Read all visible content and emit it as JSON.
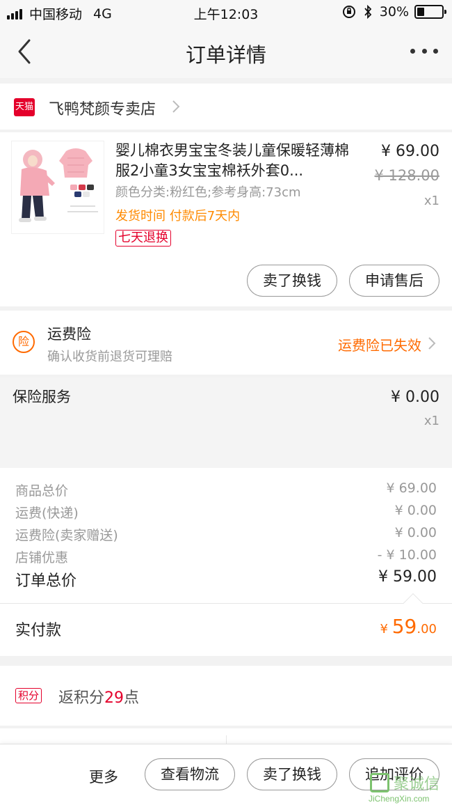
{
  "status_bar": {
    "carrier": "中国移动",
    "network": "4G",
    "time": "上午12:03",
    "battery": "30%",
    "battery_level": 0.3
  },
  "nav": {
    "title": "订单详情"
  },
  "store": {
    "badge": "天猫",
    "name": "飞鸭梵颜专卖店"
  },
  "product": {
    "title": "婴儿棉衣男宝宝冬装儿童保暖轻薄棉服2小童3女宝宝棉袄外套0...",
    "sku": "颜色分类:粉红色;参考身高:73cm",
    "ship_time": "发货时间 付款后7天内",
    "return_tag": "七天退换",
    "price": "¥ 69.00",
    "original_price": "¥ 128.00",
    "quantity": "x1",
    "btn_sell": "卖了换钱",
    "btn_after_sale": "申请售后"
  },
  "insurance": {
    "badge": "险",
    "title": "运费险",
    "desc": "确认收货前退货可理赔",
    "status": "运费险已失效"
  },
  "service": {
    "title": "保险服务",
    "price": "¥ 0.00",
    "quantity": "x1"
  },
  "summary": {
    "rows": [
      {
        "label": "商品总价",
        "value": "¥ 69.00"
      },
      {
        "label": "运费(快递)",
        "value": "¥ 0.00"
      },
      {
        "label": "运费险(卖家赠送)",
        "value": "¥ 0.00"
      },
      {
        "label": "店铺优惠",
        "value": "- ¥ 10.00"
      }
    ],
    "total_label": "订单总价",
    "total_value": "¥ 59.00"
  },
  "paid": {
    "label": "实付款",
    "currency": "¥ ",
    "integer": "59",
    "decimal": ".00"
  },
  "points": {
    "tag": "积分",
    "text": "返积分",
    "value": "29",
    "unit": "点"
  },
  "bottom_bar": {
    "more": "更多",
    "logistics": "查看物流",
    "sell": "卖了换钱",
    "review": "追加评价"
  },
  "watermark": {
    "name": "聚诚信",
    "url": "JiChengXin.com"
  },
  "colors": {
    "tmall_red": "#e4002b",
    "accent_orange": "#ff6a00",
    "ship_orange": "#ff8a00"
  }
}
